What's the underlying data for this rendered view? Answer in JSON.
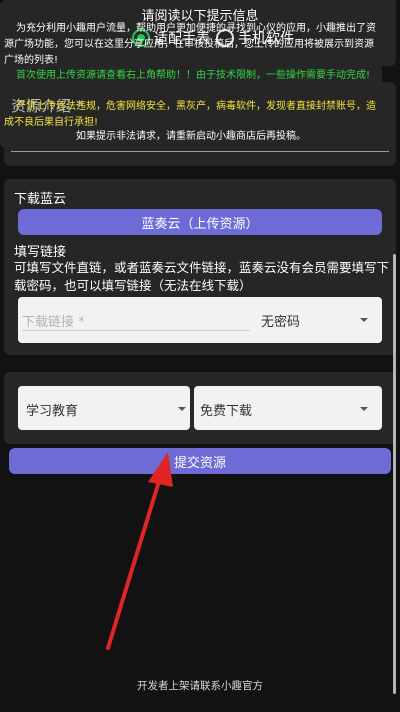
{
  "type_selector": {
    "options": [
      {
        "label": "适配手表",
        "selected": true
      },
      {
        "label": "手机软件",
        "selected": false
      }
    ]
  },
  "intro": {
    "label": "资源介绍 *"
  },
  "download": {
    "title": "下载蓝云",
    "lanzou_button": "蓝奏云（上传资源）",
    "fill_title": "填写链接",
    "fill_desc": "可填写文件直链，或者蓝奏云文件链接，蓝奏云没有会员需要填写下载密码，也可以填写链接（无法在线下载）",
    "link_placeholder": "下载链接 *",
    "password_option": "无密码"
  },
  "category": {
    "type_value": "学习教育",
    "price_value": "免费下载"
  },
  "submit_label": "提交资源",
  "notice": {
    "title": "请阅读以下提示信息",
    "p1": "为充分利用小趣用户流量，帮助用户更加便捷的寻找到心仪的应用，小趣推出了资源广场功能，您可以在这里分享应用，在审核投稿后，您上传的应用将被展示到资源广场的列表!",
    "p2": "首次使用上传资源请查看右上角帮助！！由于技术限制，一些操作需要手动完成!",
    "p3": "严禁上传违法违规，危害网络安全，黑灰产，病毒软件，发现者直接封禁账号，造成不良后果自行承担!",
    "p4": "如果提示非法请求，请重新启动小趣商店后再投稿。"
  },
  "footer": "开发者上架请联系小趣官方",
  "colors": {
    "accent": "#6e6ad6",
    "radio_on": "#23c552",
    "notice_green": "#33d645",
    "notice_yellow": "#f3e63c",
    "arrow_red": "#e02525"
  }
}
